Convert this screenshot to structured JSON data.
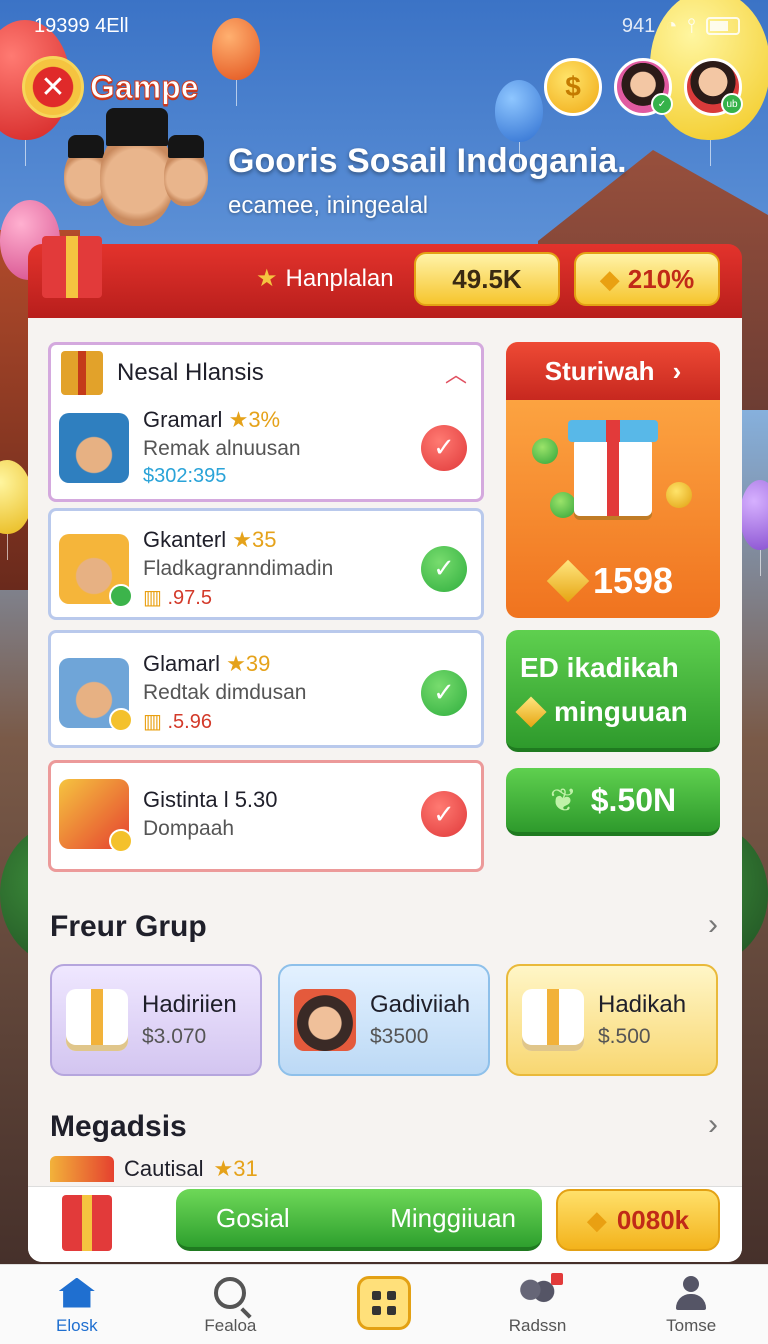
{
  "status_bar": {
    "time": "19399 4Ell",
    "right_text": "941"
  },
  "app": {
    "name": "Gampe",
    "logo_glyph": "✕"
  },
  "header_icons": [
    {
      "name": "coin-icon",
      "glyph": "$"
    },
    {
      "name": "avatar-girl"
    },
    {
      "name": "avatar-boy",
      "badge": "ub"
    }
  ],
  "hero": {
    "title": "Gooris Sosail Indogania.",
    "subtitle": "ecamee, iningealal"
  },
  "banner": {
    "label": "Hanplalan",
    "stat1": "49.5K",
    "stat2": "210%"
  },
  "tasks": {
    "header": "Nesal Hlansis",
    "items": [
      {
        "name": "Gramarl",
        "rating": "3%",
        "sub": "Remak alnuusan",
        "amount": "$302:395",
        "check": "red"
      },
      {
        "name": "Gkanterl",
        "rating": "35",
        "sub": "Fladkagranndimadin",
        "amount": ".97.5",
        "check": "green"
      },
      {
        "name": "Glamarl",
        "rating": "39",
        "sub": "Redtak dimdusan",
        "amount": ".5.96",
        "check": "green"
      },
      {
        "name": "Gistinta l 5.30",
        "rating": "",
        "sub": "Dompaah",
        "amount": "",
        "check": "red"
      }
    ]
  },
  "reward": {
    "title": "Sturiwah",
    "value": "1598"
  },
  "green_buttons": {
    "b1_line1": "ED ikadikah",
    "b1_line2": "minguuan",
    "b2": "$.50N"
  },
  "section1": {
    "title": "Freur Grup",
    "tiles": [
      {
        "name": "Hadiriien",
        "price": "$3.070"
      },
      {
        "name": "Gadiviiah",
        "price": "$3500"
      },
      {
        "name": "Hadikah",
        "price": "$.500"
      }
    ]
  },
  "section2": {
    "title": "Megadsis",
    "peek_name": "Cautisal",
    "peek_rating": "31"
  },
  "action_bar": {
    "left": "Gosial",
    "right": "Minggiiuan",
    "yellow": "0080k"
  },
  "nav": {
    "items": [
      {
        "label": "Elosk"
      },
      {
        "label": "Fealoa"
      },
      {
        "label": ""
      },
      {
        "label": "Radssn"
      },
      {
        "label": "Tomse"
      }
    ]
  },
  "colors": {
    "accent_red": "#d8261f",
    "accent_green": "#2e9a2c",
    "accent_gold": "#f3b31c",
    "nav_active": "#1f6fd0"
  }
}
